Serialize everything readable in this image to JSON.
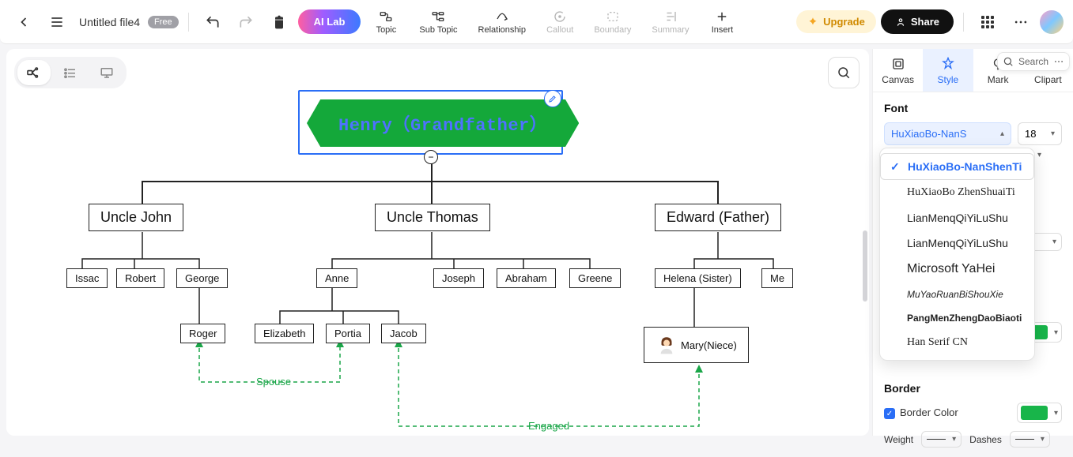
{
  "header": {
    "file_name": "Untitled file4",
    "badge": "Free",
    "ai_lab": "AI Lab",
    "toolbar_items": [
      {
        "id": "topic",
        "label": "Topic",
        "disabled": false
      },
      {
        "id": "subtopic",
        "label": "Sub Topic",
        "disabled": false
      },
      {
        "id": "relationship",
        "label": "Relationship",
        "disabled": false
      },
      {
        "id": "callout",
        "label": "Callout",
        "disabled": true
      },
      {
        "id": "boundary",
        "label": "Boundary",
        "disabled": true
      },
      {
        "id": "summary",
        "label": "Summary",
        "disabled": true
      },
      {
        "id": "insert",
        "label": "Insert",
        "disabled": false
      }
    ],
    "upgrade": "Upgrade",
    "share": "Share"
  },
  "tree": {
    "root": "Henry（Grandfather）",
    "level1": {
      "uncle_john": "Uncle John",
      "uncle_thomas": "Uncle Thomas",
      "edward": "Edward (Father)"
    },
    "level2": {
      "issac": "Issac",
      "robert": "Robert",
      "george": "George",
      "anne": "Anne",
      "joseph": "Joseph",
      "abraham": "Abraham",
      "greene": "Greene",
      "helena": "Helena (Sister)",
      "me": "Me"
    },
    "level3": {
      "roger": "Roger",
      "elizabeth": "Elizabeth",
      "portia": "Portia",
      "jacob": "Jacob",
      "mary": "Mary(Niece)"
    },
    "labels": {
      "spouse": "Spouse",
      "engaged": "Engaged"
    }
  },
  "panel": {
    "tabs": {
      "canvas": "Canvas",
      "style": "Style",
      "mark": "Mark",
      "clipart": "Clipart"
    },
    "search_placeholder": "Search",
    "sections": {
      "font": "Font",
      "border": "Border",
      "border_color": "Border Color",
      "weight": "Weight",
      "dashes": "Dashes"
    },
    "font_select_value": "HuXiaoBo-NanS",
    "font_size_value": "18",
    "font_options": [
      "HuXiaoBo-NanShenTi",
      "HuXiaoBo ZhenShuaiTi",
      "LianMenqQiYiLuShu",
      "LianMenqQiYiLuShu",
      "Microsoft YaHei",
      "MuYaoRuanBiShouXie",
      "PangMenZhengDaoBiaoti",
      "Han Serif CN"
    ],
    "font_selected_index": 0,
    "border_color_hex": "#18b54a"
  }
}
